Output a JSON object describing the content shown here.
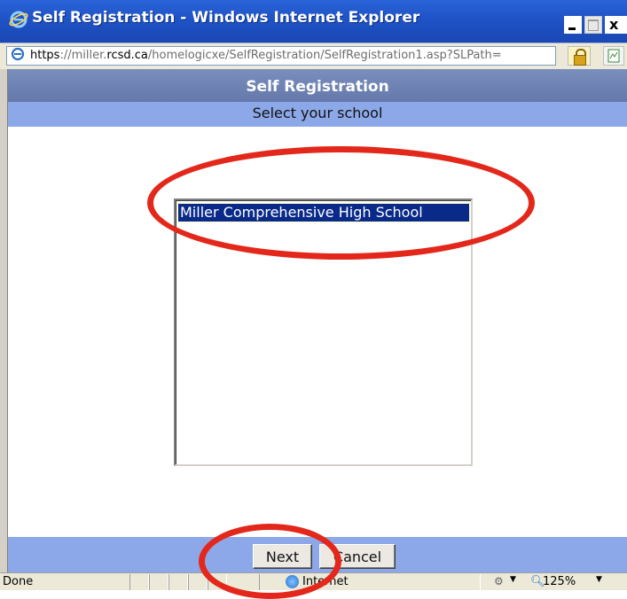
{
  "window": {
    "title": "Self Registration - Windows Internet Explorer",
    "close_label": "x"
  },
  "address": {
    "scheme": "https",
    "separator": "://",
    "sub": "miller.",
    "host": "rcsd.ca",
    "path": "/homelogicxe/SelfRegistration/SelfRegistration1.asp?SLPath="
  },
  "page": {
    "header": "Self Registration",
    "subheader": "Select your school",
    "list": {
      "options": [
        "Miller Comprehensive High School"
      ],
      "selected": "Miller Comprehensive High School"
    },
    "buttons": {
      "next": "Next",
      "cancel": "Cancel"
    }
  },
  "status": {
    "text": "Done",
    "zone": "Internet",
    "zoom": "125%"
  },
  "colors": {
    "annotation": "#e3281b",
    "header_dark": "#6b80b3",
    "header_light": "#8da8e8",
    "selection": "#0a2a8a"
  }
}
